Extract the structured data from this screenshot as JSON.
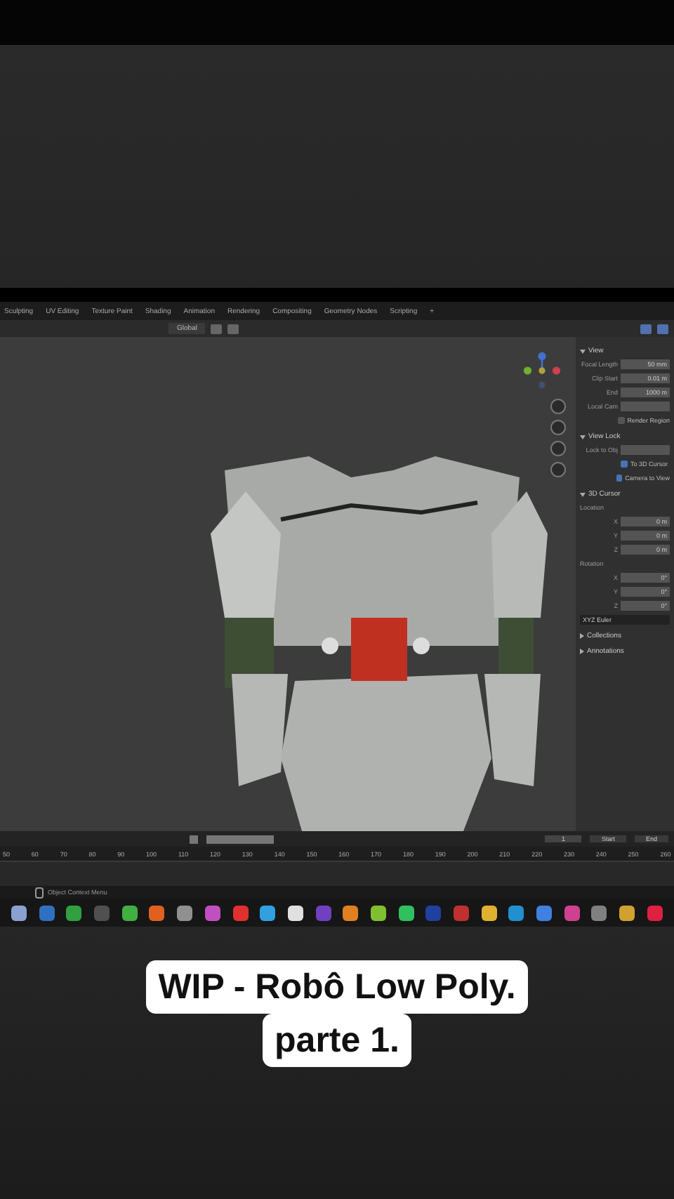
{
  "workspace_tabs": [
    {
      "label": "Sculpting"
    },
    {
      "label": "UV Editing"
    },
    {
      "label": "Texture Paint"
    },
    {
      "label": "Shading"
    },
    {
      "label": "Animation"
    },
    {
      "label": "Rendering"
    },
    {
      "label": "Compositing"
    },
    {
      "label": "Geometry Nodes"
    },
    {
      "label": "Scripting"
    },
    {
      "label": "+"
    }
  ],
  "header": {
    "transform_orientation": "Global"
  },
  "sidebar": {
    "sections": [
      {
        "title": "View",
        "expanded": true,
        "rows": [
          {
            "kind": "field",
            "label": "Focal Length",
            "value": "50 mm"
          },
          {
            "kind": "field",
            "label": "Clip Start",
            "value": "0.01 m"
          },
          {
            "kind": "field",
            "label": "End",
            "value": "1000 m"
          },
          {
            "kind": "field",
            "label": "Local Cam",
            "value": ""
          },
          {
            "kind": "check",
            "label": "Render Region",
            "checked": false
          }
        ]
      },
      {
        "title": "View Lock",
        "expanded": true,
        "rows": [
          {
            "kind": "field",
            "label": "Lock to Obj",
            "value": ""
          },
          {
            "kind": "check",
            "label": "To 3D Cursor",
            "checked": true
          },
          {
            "kind": "check",
            "label": "Camera to View",
            "checked": true
          }
        ]
      },
      {
        "title": "3D Cursor",
        "expanded": true,
        "rows": [
          {
            "kind": "heading",
            "label": "Location"
          },
          {
            "kind": "field",
            "label": "X",
            "value": "0 m"
          },
          {
            "kind": "field",
            "label": "Y",
            "value": "0 m"
          },
          {
            "kind": "field",
            "label": "Z",
            "value": "0 m"
          },
          {
            "kind": "heading",
            "label": "Rotation"
          },
          {
            "kind": "field",
            "label": "X",
            "value": "0°"
          },
          {
            "kind": "field",
            "label": "Y",
            "value": "0°"
          },
          {
            "kind": "field",
            "label": "Z",
            "value": "0°"
          },
          {
            "kind": "dropdown",
            "label": "",
            "value": "XYZ Euler"
          }
        ]
      },
      {
        "title": "Collections",
        "expanded": false
      },
      {
        "title": "Annotations",
        "expanded": false
      }
    ]
  },
  "timeline": {
    "ticks": [
      "50",
      "60",
      "70",
      "80",
      "90",
      "100",
      "110",
      "120",
      "130",
      "140",
      "150",
      "160",
      "170",
      "180",
      "190",
      "200",
      "210",
      "220",
      "230",
      "240",
      "250",
      "260"
    ],
    "current_frame": "1",
    "start_label": "Start",
    "end_label": "End"
  },
  "status_bar": {
    "hint": "Object Context Menu"
  },
  "taskbar": {
    "apps": [
      {
        "color": "#8aa0d0"
      },
      {
        "color": "#3070c0"
      },
      {
        "color": "#30a040"
      },
      {
        "color": "#505050"
      },
      {
        "color": "#40b040"
      },
      {
        "color": "#e06020"
      },
      {
        "color": "#909090"
      },
      {
        "color": "#c050c0"
      },
      {
        "color": "#e03030"
      },
      {
        "color": "#30a0e0"
      },
      {
        "color": "#e0e0e0"
      },
      {
        "color": "#7040c0"
      },
      {
        "color": "#e08020"
      },
      {
        "color": "#80c030"
      },
      {
        "color": "#30c060"
      },
      {
        "color": "#2040a0"
      },
      {
        "color": "#c03030"
      },
      {
        "color": "#e0b030"
      },
      {
        "color": "#2090d0"
      },
      {
        "color": "#4080e0"
      },
      {
        "color": "#d04090"
      },
      {
        "color": "#808080"
      },
      {
        "color": "#d0a030"
      },
      {
        "color": "#e02040"
      }
    ]
  },
  "caption": {
    "lines": [
      "WIP - Robô Low Poly.",
      "parte 1."
    ]
  }
}
